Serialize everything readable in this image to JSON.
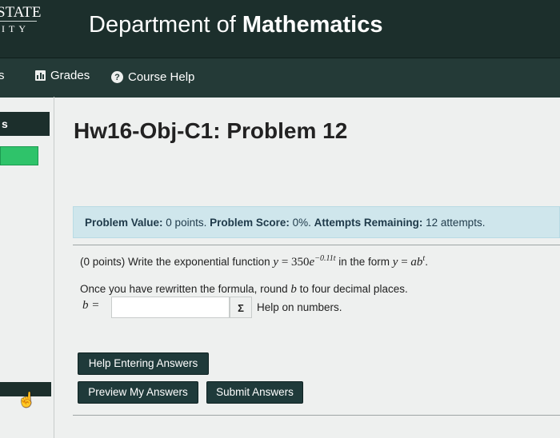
{
  "header": {
    "logo_line1": "STATE",
    "logo_line2": "ITY",
    "dept_prefix": "Department of ",
    "dept_bold": "Mathematics"
  },
  "nav": {
    "cut_label": "s",
    "grades_label": "Grades",
    "course_help_label": "Course Help",
    "help_glyph": "?"
  },
  "sidebar": {
    "cut_label": "s"
  },
  "problem": {
    "title": "Hw16-Obj-C1: Problem 12",
    "value_label": "Problem Value:",
    "value_text": " 0 points. ",
    "score_label": "Problem Score:",
    "score_text": " 0%. ",
    "attempts_label": "Attempts Remaining:",
    "attempts_text": " 12 attempts.",
    "statement_prefix": "(0 points) Write the exponential function ",
    "func_y": "y",
    "func_eq": " = 350",
    "func_e": "e",
    "func_exp": "−0.11t",
    "statement_mid": " in the form ",
    "form_y": "y",
    "form_eq": " = ",
    "form_ab": "ab",
    "form_exp": "t",
    "statement_end": ".",
    "round_prefix": "Once you have rewritten the formula, round ",
    "round_var": "b",
    "round_suffix": " to four decimal places.",
    "answer_label": "b =",
    "answer_value": "",
    "sigma_label": "Σ",
    "help_numbers": "Help on numbers."
  },
  "buttons": {
    "help_entering": "Help Entering Answers",
    "preview": "Preview My Answers",
    "submit": "Submit Answers"
  },
  "colors": {
    "header_bg": "#1c2f2c",
    "nav_bg": "#243a37",
    "info_bg": "#cfe6ec",
    "button_bg": "#1f3a3a",
    "sidebar_active": "#2fc36a"
  }
}
